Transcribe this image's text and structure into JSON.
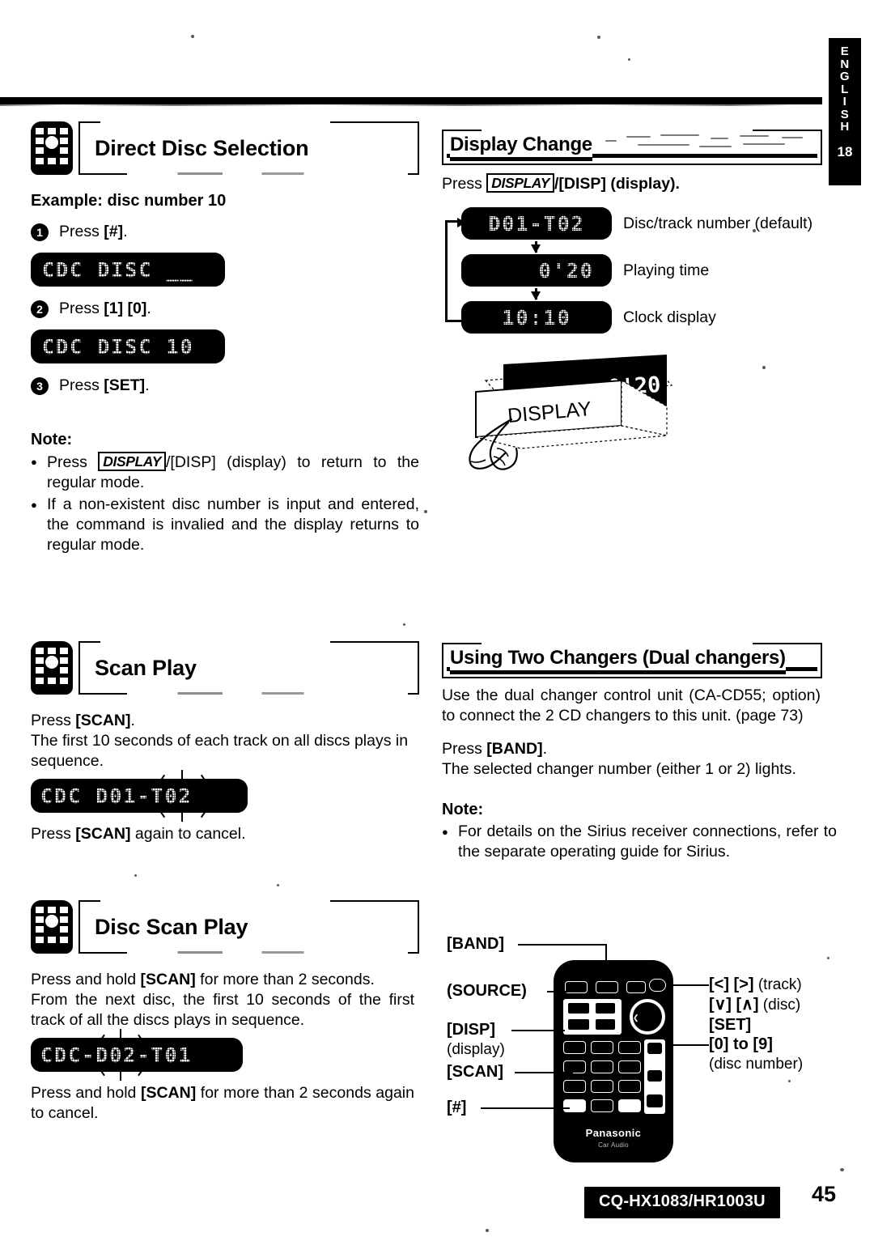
{
  "page": {
    "language_tab": {
      "letters": [
        "E",
        "N",
        "G",
        "L",
        "I",
        "S",
        "H"
      ],
      "chapter": "18"
    },
    "model": "CQ-HX1083/HR1003U",
    "page_number": "45"
  },
  "left_column": {
    "direct_disc": {
      "icon": "remote-keypad-icon",
      "title": "Direct Disc Selection",
      "example_label": "Example: disc number 10",
      "steps": [
        {
          "num": "1",
          "text_prefix": "Press ",
          "key": "[#]",
          "text_suffix": "."
        },
        {
          "num": "2",
          "text_prefix": "Press ",
          "key": "[1] [0]",
          "text_suffix": "."
        },
        {
          "num": "3",
          "text_prefix": "Press ",
          "key": "[SET]",
          "text_suffix": "."
        }
      ],
      "lcd_after_step1": "CDC DISC __",
      "lcd_after_step2": "CDC DISC 10",
      "note_heading": "Note:",
      "notes": [
        {
          "pre": "Press ",
          "keybox": "DISPLAY",
          "post": "/[DISP] (display) to return to the regular mode."
        },
        {
          "pre": "",
          "keybox": "",
          "post": "If a non-existent disc number is input and entered, the command is invalied and the display returns to regular mode."
        }
      ]
    },
    "scan_play": {
      "icon": "remote-keypad-icon",
      "title": "Scan Play",
      "line1_pre": "Press ",
      "line1_key": "[SCAN]",
      "line1_post": ".",
      "line2": "The first 10 seconds of each track on all discs plays in sequence.",
      "lcd": "CDC D01-T02",
      "lcd_blink_segment": "T02",
      "line3_pre": "Press ",
      "line3_key": "[SCAN]",
      "line3_post": " again to cancel."
    },
    "disc_scan_play": {
      "icon": "remote-keypad-icon",
      "title": "Disc Scan Play",
      "line1_pre": "Press and hold ",
      "line1_key": "[SCAN]",
      "line1_post": " for more than 2 seconds.",
      "line2": "From the next disc, the first 10 seconds of the first track of all the discs plays in sequence.",
      "lcd": "CDC-D02-T01",
      "lcd_blink_segment": "D02",
      "line3_pre": "Press and hold ",
      "line3_key": "[SCAN]",
      "line3_post": " for more than 2 seconds again to cancel."
    }
  },
  "right_column": {
    "display_change": {
      "title": "Display Change",
      "press_pre": "Press ",
      "press_keybox": "DISPLAY",
      "press_post": "/[DISP] (display).",
      "flow": [
        {
          "lcd": "D01-T02",
          "label": "Disc/track number (default)"
        },
        {
          "lcd": "0'20",
          "label": "Playing time"
        },
        {
          "lcd": "10:10",
          "label": "Clock display"
        }
      ],
      "illustration": {
        "name": "display-panel-illustration",
        "panel_text": "DISPLAY",
        "screen_text": "0'20"
      }
    },
    "dual_changers": {
      "title": "Using Two Changers (Dual changers)",
      "para1": "Use the dual changer control unit (CA-CD55; option) to connect the 2 CD changers to this unit. (page 73)",
      "press_pre": "Press ",
      "press_key": "[BAND]",
      "press_post": ".",
      "para2": "The selected changer number (either 1 or 2) lights.",
      "note_heading": "Note:",
      "note": "For details on the Sirius receiver connections, refer to the separate operating guide for Sirius."
    },
    "remote_figure": {
      "name": "remote-control-diagram",
      "brand": "Panasonic",
      "sub_brand": "Car Audio",
      "left_callouts": [
        {
          "label": "[BAND]",
          "sub": ""
        },
        {
          "label": "(SOURCE)",
          "sub": ""
        },
        {
          "label": "[DISP]",
          "sub": "(display)"
        },
        {
          "label": "[SCAN]",
          "sub": ""
        },
        {
          "label": "[#]",
          "sub": ""
        }
      ],
      "right_callouts": [
        {
          "label": "[<] [>]",
          "sub": "(track)"
        },
        {
          "label": "[∨] [∧]",
          "sub": "(disc)"
        },
        {
          "label": "[SET]",
          "sub": ""
        },
        {
          "label": "[0] to [9]",
          "sub": "(disc number)"
        }
      ]
    }
  }
}
